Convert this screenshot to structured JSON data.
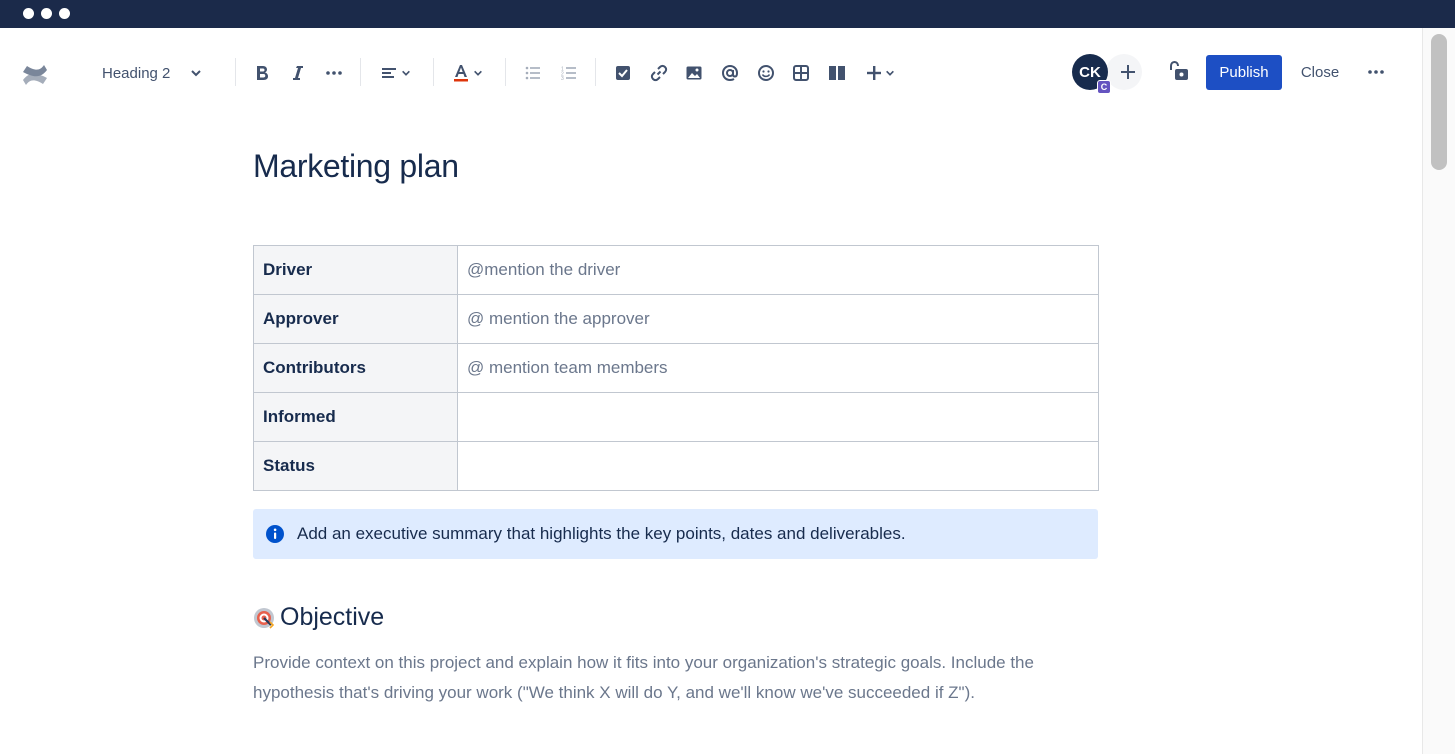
{
  "toolbar": {
    "text_style": "Heading 2",
    "avatar_initials": "CK",
    "avatar_badge": "C",
    "publish_label": "Publish",
    "close_label": "Close",
    "icons": [
      "confluence-logo-icon",
      "bold-icon",
      "italic-icon",
      "more-formatting-icon",
      "align-icon",
      "text-color-icon",
      "bullet-list-icon",
      "numbered-list-icon",
      "action-item-icon",
      "link-icon",
      "image-icon",
      "mention-icon",
      "emoji-icon",
      "table-icon",
      "layout-icon",
      "insert-icon",
      "invite-icon",
      "restrictions-icon",
      "more-icon"
    ]
  },
  "page": {
    "title": "Marketing plan"
  },
  "meta_table": {
    "rows": [
      {
        "key": "Driver",
        "value": "@mention the driver"
      },
      {
        "key": "Approver",
        "value": "@ mention the approver"
      },
      {
        "key": "Contributors",
        "value": "@ mention team members"
      },
      {
        "key": "Informed",
        "value": ""
      },
      {
        "key": "Status",
        "value": ""
      }
    ]
  },
  "info_panel": {
    "text": "Add an executive summary that highlights the key points, dates and deliverables."
  },
  "objective": {
    "title": "Objective",
    "emoji": "target-emoji",
    "text": "Provide context on this project and explain how it fits into your organization's strategic goals. Include the hypothesis that's driving your work (\"We think X will do Y, and we'll know we've succeeded if Z\")."
  },
  "colors": {
    "titlebar": "#1b2a4a",
    "publish": "#1d4fc4",
    "panel_bg": "#deebff",
    "info_icon": "#0052cc"
  }
}
